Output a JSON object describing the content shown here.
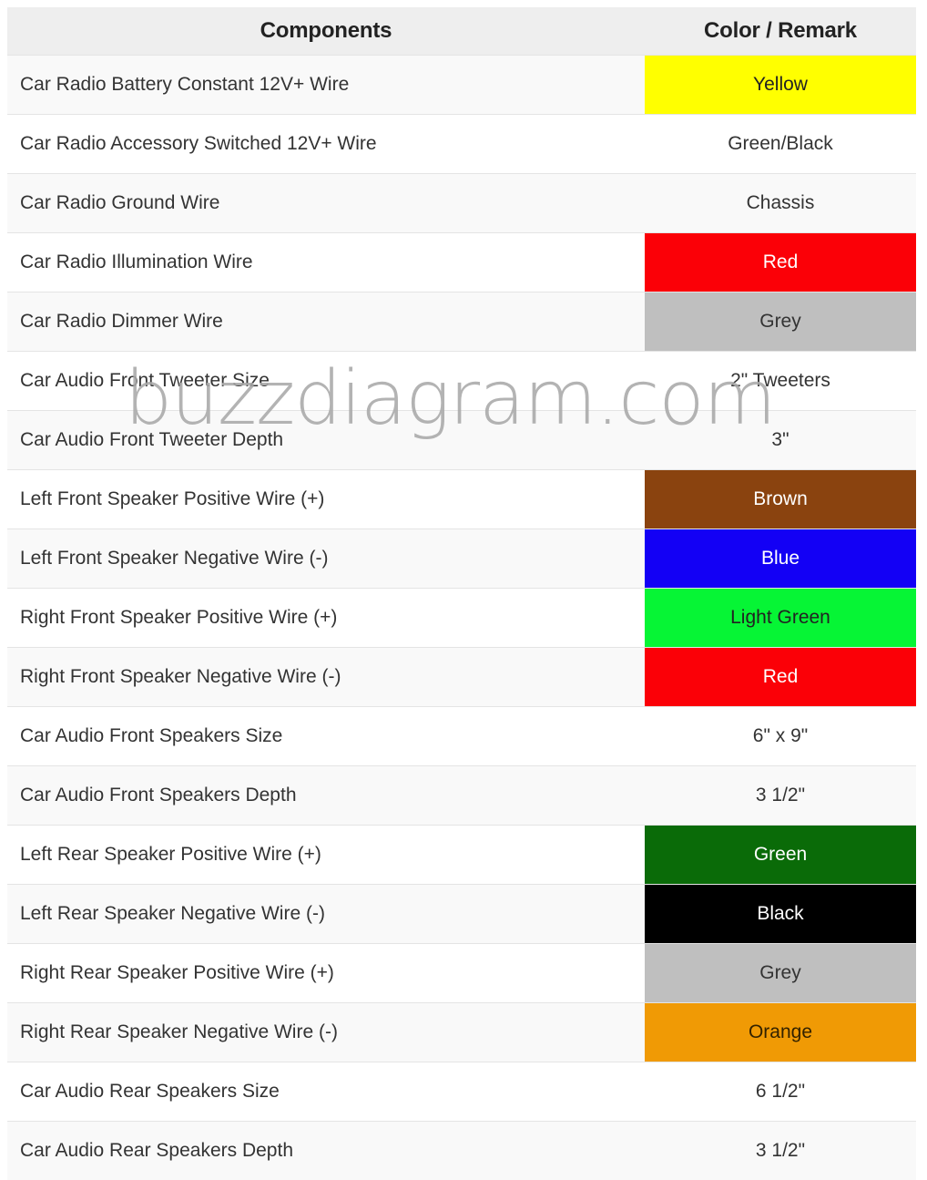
{
  "page": {
    "watermark": "buzzdiagram.com"
  },
  "table": {
    "headers": {
      "components": "Components",
      "color_remark": "Color / Remark"
    },
    "rows": [
      {
        "component": "Car Radio Battery Constant 12V+ Wire",
        "value": "Yellow",
        "bg": "#FFFF00",
        "fg": "#222222",
        "has_swatch": true
      },
      {
        "component": "Car Radio Accessory Switched 12V+ Wire",
        "value": "Green/Black",
        "bg": "",
        "fg": "#333333",
        "has_swatch": false
      },
      {
        "component": "Car Radio Ground Wire",
        "value": "Chassis",
        "bg": "",
        "fg": "#333333",
        "has_swatch": false
      },
      {
        "component": "Car Radio Illumination Wire",
        "value": "Red",
        "bg": "#FB0007",
        "fg": "#FFFFFF",
        "has_swatch": true
      },
      {
        "component": "Car Radio Dimmer Wire",
        "value": "Grey",
        "bg": "#BFBFBF",
        "fg": "#333333",
        "has_swatch": true
      },
      {
        "component": "Car Audio Front Tweeter Size",
        "value": "2\" Tweeters",
        "bg": "",
        "fg": "#333333",
        "has_swatch": false
      },
      {
        "component": "Car Audio Front Tweeter Depth",
        "value": "3\"",
        "bg": "",
        "fg": "#333333",
        "has_swatch": false
      },
      {
        "component": "Left Front Speaker Positive Wire (+)",
        "value": "Brown",
        "bg": "#8A430F",
        "fg": "#FFFFFF",
        "has_swatch": true
      },
      {
        "component": "Left Front Speaker Negative Wire (-)",
        "value": "Blue",
        "bg": "#1300F5",
        "fg": "#FFFFFF",
        "has_swatch": true
      },
      {
        "component": "Right Front Speaker Positive Wire (+)",
        "value": "Light Green",
        "bg": "#06F535",
        "fg": "#222222",
        "has_swatch": true
      },
      {
        "component": "Right Front Speaker Negative Wire (-)",
        "value": "Red",
        "bg": "#FB0007",
        "fg": "#FFFFFF",
        "has_swatch": true
      },
      {
        "component": "Car Audio Front Speakers Size",
        "value": "6\" x 9\"",
        "bg": "",
        "fg": "#333333",
        "has_swatch": false
      },
      {
        "component": "Car Audio Front Speakers Depth",
        "value": "3 1/2\"",
        "bg": "",
        "fg": "#333333",
        "has_swatch": false
      },
      {
        "component": "Left Rear Speaker Positive Wire (+)",
        "value": "Green",
        "bg": "#0A6B08",
        "fg": "#FFFFFF",
        "has_swatch": true
      },
      {
        "component": "Left Rear Speaker Negative Wire (-)",
        "value": "Black",
        "bg": "#000000",
        "fg": "#FFFFFF",
        "has_swatch": true
      },
      {
        "component": "Right Rear Speaker Positive Wire (+)",
        "value": "Grey",
        "bg": "#BFBFBF",
        "fg": "#333333",
        "has_swatch": true
      },
      {
        "component": "Right Rear Speaker Negative Wire (-)",
        "value": "Orange",
        "bg": "#F09A05",
        "fg": "#332200",
        "has_swatch": true
      },
      {
        "component": "Car Audio Rear Speakers Size",
        "value": "6 1/2\"",
        "bg": "",
        "fg": "#333333",
        "has_swatch": false
      },
      {
        "component": "Car Audio Rear Speakers Depth",
        "value": "3 1/2\"",
        "bg": "",
        "fg": "#333333",
        "has_swatch": false
      }
    ]
  }
}
